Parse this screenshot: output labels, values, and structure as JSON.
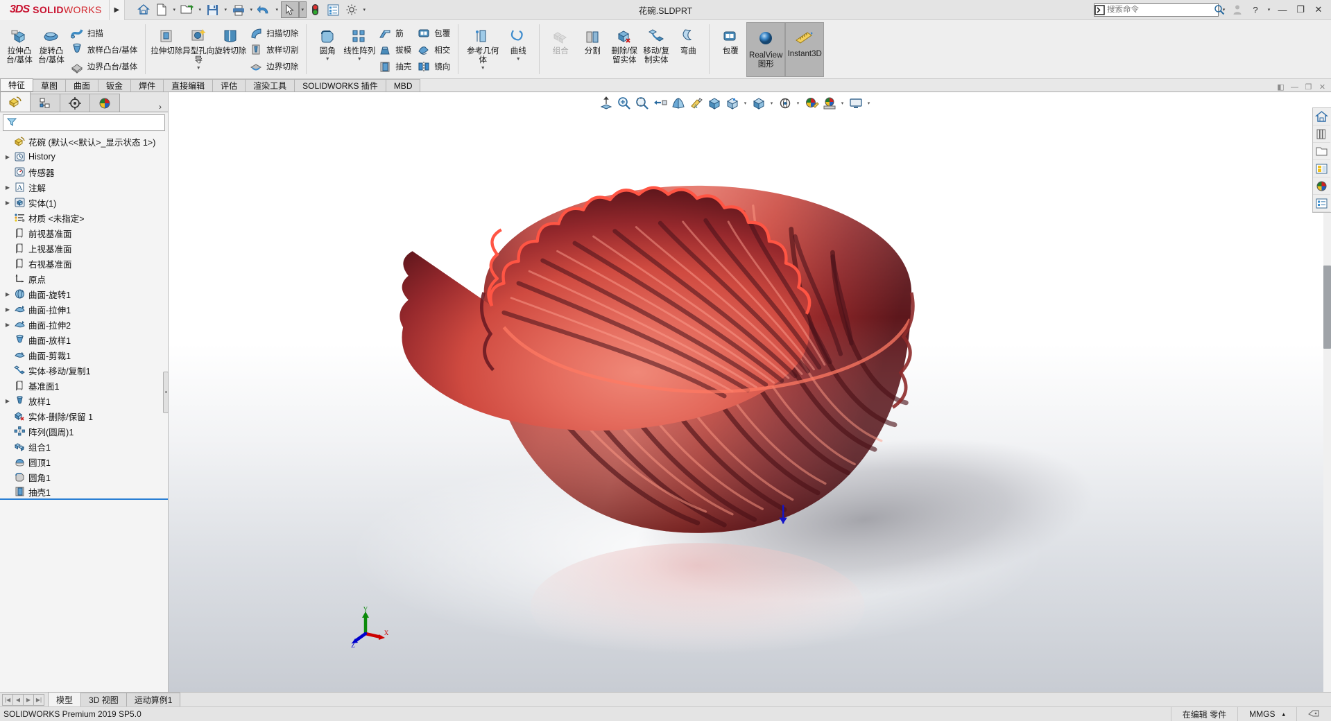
{
  "app": {
    "brand_ds": "3DS",
    "brand_solid": "SOLID",
    "brand_works": "WORKS",
    "document_title": "花碗.SLDPRT",
    "accent_red": "#c8102e",
    "accent_blue": "#2a7fd4"
  },
  "quick_access": {
    "items": [
      {
        "name": "home-icon",
        "caret": false
      },
      {
        "name": "new-document-icon",
        "caret": true
      },
      {
        "name": "open-folder-icon",
        "caret": true
      },
      {
        "name": "save-icon",
        "caret": true
      },
      {
        "name": "print-icon",
        "caret": true
      },
      {
        "name": "undo-icon",
        "caret": true
      },
      {
        "name": "select-arrow-icon",
        "caret": true,
        "selected": true
      },
      {
        "name": "rebuild-icon",
        "caret": false
      },
      {
        "name": "options-list-icon",
        "caret": false
      },
      {
        "name": "settings-gear-icon",
        "caret": true
      }
    ]
  },
  "search": {
    "placeholder": "搜索命令",
    "icon": "search-command-icon"
  },
  "window_controls": {
    "account": "account-icon",
    "help": "?",
    "help_caret": "▾",
    "minimize": "—",
    "restore": "❐",
    "close": "✕"
  },
  "ribbon": {
    "groups": [
      {
        "big": [
          {
            "label": "拉伸凸台/基体",
            "icon": "extrude-boss-icon",
            "caret": false
          },
          {
            "label": "旋转凸台/基体",
            "icon": "revolve-boss-icon",
            "caret": false
          }
        ],
        "small": [
          {
            "label": "扫描",
            "icon": "sweep-icon"
          },
          {
            "label": "放样凸台/基体",
            "icon": "loft-boss-icon"
          },
          {
            "label": "边界凸台/基体",
            "icon": "boundary-boss-icon"
          }
        ]
      },
      {
        "big": [
          {
            "label": "拉伸切除",
            "icon": "extrude-cut-icon",
            "caret": false
          },
          {
            "label": "异型孔向导",
            "icon": "hole-wizard-icon",
            "caret": true
          },
          {
            "label": "旋转切除",
            "icon": "revolve-cut-icon",
            "caret": false
          }
        ],
        "small": [
          {
            "label": "扫描切除",
            "icon": "sweep-cut-icon"
          },
          {
            "label": "放样切割",
            "icon": "loft-cut-icon"
          },
          {
            "label": "边界切除",
            "icon": "boundary-cut-icon"
          }
        ]
      },
      {
        "big": [
          {
            "label": "圆角",
            "icon": "fillet-icon",
            "caret": true
          },
          {
            "label": "线性阵列",
            "icon": "linear-pattern-icon",
            "caret": true
          }
        ],
        "small": [
          {
            "label": "筋",
            "icon": "rib-icon"
          },
          {
            "label": "拔模",
            "icon": "draft-icon"
          },
          {
            "label": "抽壳",
            "icon": "shell-icon"
          }
        ],
        "small2": [
          {
            "label": "包覆",
            "icon": "wrap-icon"
          },
          {
            "label": "相交",
            "icon": "intersect-icon"
          },
          {
            "label": "镜向",
            "icon": "mirror-icon"
          }
        ]
      },
      {
        "big": [
          {
            "label": "参考几何体",
            "icon": "reference-geometry-icon",
            "caret": true
          },
          {
            "label": "曲线",
            "icon": "curves-icon",
            "caret": true
          }
        ]
      },
      {
        "big": [
          {
            "label": "组合",
            "icon": "combine-icon",
            "caret": false,
            "disabled": true
          },
          {
            "label": "分割",
            "icon": "split-icon",
            "caret": false
          },
          {
            "label": "删除/保留实体",
            "icon": "delete-keep-body-icon",
            "caret": false
          },
          {
            "label": "移动/复制实体",
            "icon": "move-copy-body-icon",
            "caret": false
          },
          {
            "label": "弯曲",
            "icon": "flex-icon",
            "caret": false
          }
        ]
      },
      {
        "big": [
          {
            "label": "包覆",
            "icon": "wrap2-icon",
            "caret": false
          }
        ],
        "toggles": [
          {
            "label": "RealView 图形",
            "icon": "realview-sphere-icon",
            "on": true
          },
          {
            "label": "Instant3D",
            "icon": "instant3d-icon",
            "on": true
          }
        ]
      }
    ]
  },
  "command_tabs": {
    "items": [
      {
        "label": "特征",
        "selected": true
      },
      {
        "label": "草图",
        "selected": false
      },
      {
        "label": "曲面",
        "selected": false
      },
      {
        "label": "钣金",
        "selected": false
      },
      {
        "label": "焊件",
        "selected": false
      },
      {
        "label": "直接编辑",
        "selected": false
      },
      {
        "label": "评估",
        "selected": false
      },
      {
        "label": "渲染工具",
        "selected": false
      },
      {
        "label": "SOLIDWORKS 插件",
        "selected": false
      },
      {
        "label": "MBD",
        "selected": false
      }
    ],
    "dock_buttons": [
      "◧",
      "—",
      "❐",
      "✕"
    ]
  },
  "left_panel": {
    "tabs": [
      {
        "name": "feature-manager-tab",
        "icon": "feature-tree-icon",
        "selected": true
      },
      {
        "name": "property-manager-tab",
        "icon": "property-manager-icon",
        "selected": false
      },
      {
        "name": "configuration-manager-tab",
        "icon": "configuration-icon",
        "selected": false
      },
      {
        "name": "display-manager-tab",
        "icon": "display-manager-icon",
        "selected": false
      }
    ],
    "filter_placeholder": "",
    "filter_icon": "filter-funnel-icon",
    "tree": [
      {
        "label": "花碗  (默认<<默认>_显示状态 1>)",
        "icon": "part-root-icon",
        "arrow": false,
        "indent": 0,
        "root": true
      },
      {
        "label": "History",
        "icon": "history-icon",
        "arrow": true,
        "indent": 1
      },
      {
        "label": "传感器",
        "icon": "sensors-icon",
        "arrow": false,
        "indent": 1
      },
      {
        "label": "注解",
        "icon": "annotations-icon",
        "arrow": true,
        "indent": 1
      },
      {
        "label": "实体(1)",
        "icon": "solid-bodies-icon",
        "arrow": true,
        "indent": 1
      },
      {
        "label": "材质 <未指定>",
        "icon": "material-icon",
        "arrow": false,
        "indent": 1
      },
      {
        "label": "前视基准面",
        "icon": "plane-icon",
        "arrow": false,
        "indent": 1
      },
      {
        "label": "上视基准面",
        "icon": "plane-icon",
        "arrow": false,
        "indent": 1
      },
      {
        "label": "右视基准面",
        "icon": "plane-icon",
        "arrow": false,
        "indent": 1
      },
      {
        "label": "原点",
        "icon": "origin-icon",
        "arrow": false,
        "indent": 1
      },
      {
        "label": "曲面-旋转1",
        "icon": "surface-revolve-icon",
        "arrow": true,
        "indent": 1
      },
      {
        "label": "曲面-拉伸1",
        "icon": "surface-extrude-icon",
        "arrow": true,
        "indent": 1
      },
      {
        "label": "曲面-拉伸2",
        "icon": "surface-extrude-icon",
        "arrow": true,
        "indent": 1
      },
      {
        "label": "曲面-放样1",
        "icon": "surface-loft-icon",
        "arrow": false,
        "indent": 1
      },
      {
        "label": "曲面-剪裁1",
        "icon": "surface-trim-icon",
        "arrow": false,
        "indent": 1
      },
      {
        "label": "实体-移动/复制1",
        "icon": "body-move-copy-icon",
        "arrow": false,
        "indent": 1
      },
      {
        "label": "基准面1",
        "icon": "plane-icon",
        "arrow": false,
        "indent": 1
      },
      {
        "label": "放样1",
        "icon": "loft-feature-icon",
        "arrow": true,
        "indent": 1
      },
      {
        "label": "实体-删除/保留 1",
        "icon": "body-delete-keep-icon",
        "arrow": false,
        "indent": 1
      },
      {
        "label": "阵列(圆周)1",
        "icon": "circular-pattern-icon",
        "arrow": false,
        "indent": 1
      },
      {
        "label": "组合1",
        "icon": "combine-feature-icon",
        "arrow": false,
        "indent": 1
      },
      {
        "label": "圆顶1",
        "icon": "dome-icon",
        "arrow": false,
        "indent": 1
      },
      {
        "label": "圆角1",
        "icon": "fillet-feature-icon",
        "arrow": false,
        "indent": 1
      },
      {
        "label": "抽壳1",
        "icon": "shell-feature-icon",
        "arrow": false,
        "indent": 1,
        "last_selected": true
      }
    ]
  },
  "view_toolbar": {
    "items": [
      {
        "name": "zoom-to-fit-icon",
        "caret": false
      },
      {
        "name": "zoom-to-area-icon",
        "caret": false
      },
      {
        "name": "previous-view-icon",
        "caret": false
      },
      {
        "name": "section-view-icon",
        "caret": false
      },
      {
        "name": "view-orientation-icon",
        "caret": false
      },
      {
        "name": "display-style-icon",
        "caret": false
      },
      {
        "name": "view-cube-icon",
        "caret": false
      },
      {
        "name": "hide-show-items-icon",
        "caret": true
      },
      {
        "name": "edit-appearance-icon",
        "caret": true
      },
      {
        "name": "apply-scene-icon",
        "caret": true
      },
      {
        "name": "view-settings-icon",
        "caret": true
      },
      {
        "name": "viewport-icon",
        "caret": true
      }
    ]
  },
  "right_toolbar": {
    "items": [
      {
        "name": "design-library-home-icon"
      },
      {
        "name": "design-library-icon"
      },
      {
        "name": "file-explorer-icon"
      },
      {
        "name": "view-palette-icon"
      },
      {
        "name": "appearances-scenes-icon"
      },
      {
        "name": "custom-properties-icon"
      }
    ]
  },
  "graphics": {
    "model_name": "花碗",
    "triad_axes": [
      {
        "label": "Y",
        "color": "#0a8a0a"
      },
      {
        "label": "X",
        "color": "#cc0000"
      },
      {
        "label": "Z",
        "color": "#0000cc"
      }
    ],
    "model_colors": {
      "highlight": "#ff5a4a",
      "mid": "#d4ararr",
      "base": "#c2392f",
      "dark": "#5c1a1c",
      "outline": "#ff4b3a"
    }
  },
  "bottom_tabs": {
    "nav": [
      "|◀",
      "◀",
      "▶",
      "▶|"
    ],
    "items": [
      {
        "label": "模型",
        "selected": true
      },
      {
        "label": "3D 视图",
        "selected": false
      },
      {
        "label": "运动算例1",
        "selected": false
      }
    ]
  },
  "status_bar": {
    "left": "SOLIDWORKS Premium 2019 SP5.0",
    "editing": "在编辑 零件",
    "units": "MMGS",
    "units_caret": "▴",
    "tag_icon": "tag-icon"
  }
}
